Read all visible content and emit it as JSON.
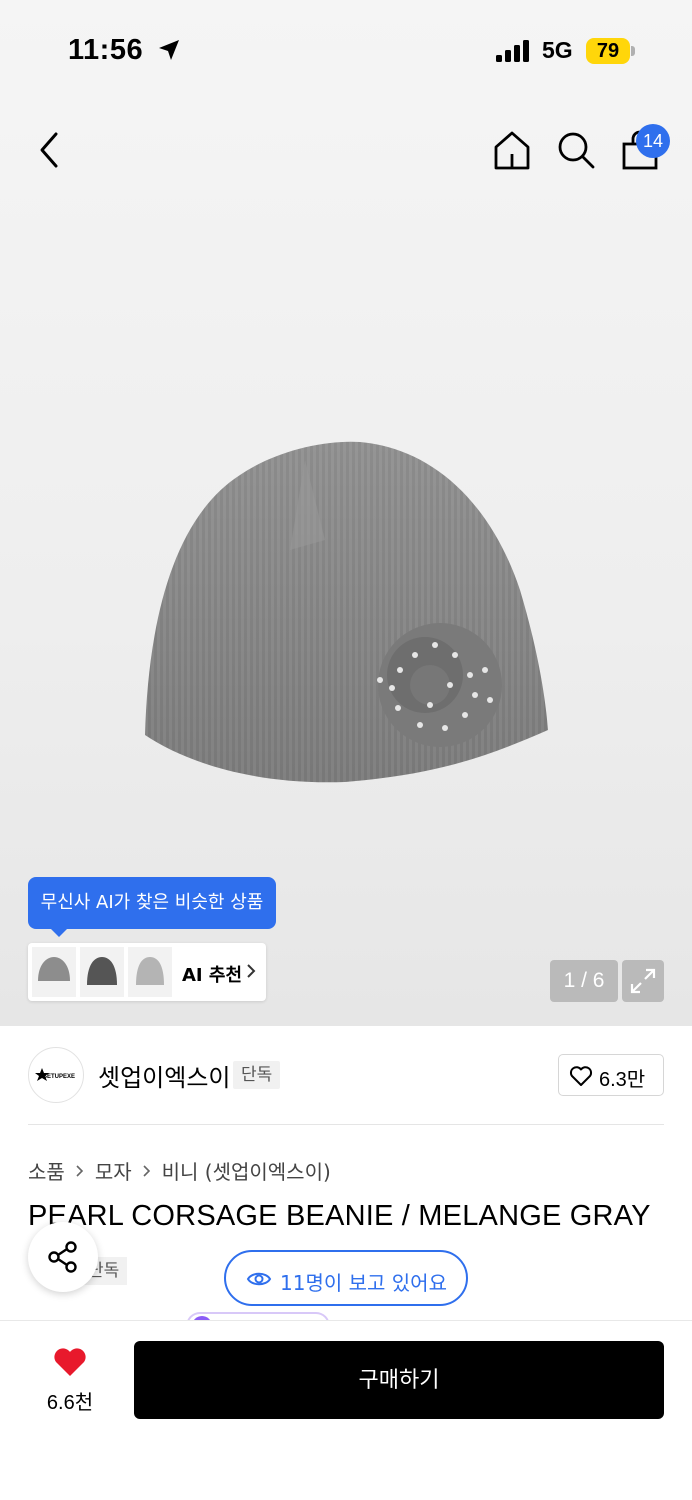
{
  "status_bar": {
    "time": "11:56",
    "network": "5G",
    "battery": "79"
  },
  "header": {
    "cart_count": "14",
    "icons": [
      "back-icon",
      "home-icon",
      "search-icon",
      "shopping-bag-icon"
    ]
  },
  "gallery": {
    "page_indicator": "1 / 6",
    "ai_tooltip": "무신사 AI가 찾은 비슷한 상품",
    "ai_recommend_label": "AI 추천"
  },
  "brand": {
    "name": "셋업이엑스이",
    "tag": "단독",
    "likes": "6.3만",
    "logo_text": "SETUPEXE"
  },
  "breadcrumb": [
    "소품",
    "모자",
    "비니 (셋업이엑스이)"
  ],
  "product": {
    "title": "PEARL CORSAGE BEANIE / MELANGE GRAY",
    "tag": "단독"
  },
  "viewers": {
    "text": "11명이 보고 있어요"
  },
  "bottom_bar": {
    "like_count": "6.6천",
    "buy_label": "구매하기"
  },
  "colors": {
    "accent": "#2f6fed",
    "buy_button": "#000000",
    "heart": "#e8192c",
    "battery": "#ffd60a"
  }
}
